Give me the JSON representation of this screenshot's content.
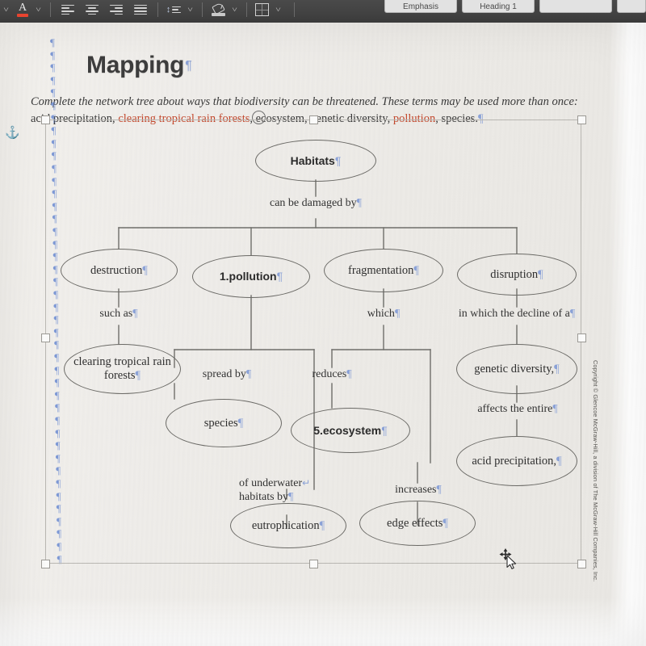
{
  "toolbar": {
    "font_color": {
      "icon": "font-color-A-icon",
      "swatch_color": "#e8442f"
    },
    "items": [
      {
        "icon": "chevron-down-icon"
      },
      {
        "icon": "align-left-icon"
      },
      {
        "icon": "align-center-icon"
      },
      {
        "icon": "align-right-icon"
      },
      {
        "icon": "align-justify-icon"
      },
      {
        "icon": "line-spacing-icon"
      },
      {
        "icon": "shading-icon"
      },
      {
        "icon": "borders-icon"
      }
    ],
    "style_gallery": [
      {
        "label": "Emphasis"
      },
      {
        "label": "Heading 1"
      },
      {
        "label": ""
      },
      {
        "label": ""
      }
    ]
  },
  "document": {
    "title": "Mapping",
    "title_pilcrow": "¶",
    "instructions": {
      "line1_italic": "Complete the network tree about ways that biodiversity can be threatened. These terms may be used more than",
      "line2_italic_lead": "once:",
      "term_1": " acid precipitation, ",
      "term_2": "clearing tropical rain forests",
      "sep_2": ", ",
      "term_3": "ecosystem",
      "sep_3": ", ",
      "term_4": "genetic diversity",
      "sep_4": ", ",
      "term_5": "pollution",
      "sep_5": ", ",
      "term_6": "species.",
      "pilcrow": "¶"
    },
    "copyright": "Copyright © Glencoe McGraw-Hill, a division of The McGraw-Hill Companies, Inc."
  },
  "selection": {
    "handle_name": "resize-handle",
    "anchor_icon": "object-anchor-icon"
  },
  "pilcrow_mark": "¶",
  "line_break_mark": "↵",
  "diagram": {
    "nodes": [
      {
        "id": "habitats",
        "label": "Habitats",
        "bold": true,
        "pilcrow": "¶"
      },
      {
        "id": "destruction",
        "label": "destruction",
        "bold": false,
        "pilcrow": "¶"
      },
      {
        "id": "pollution",
        "label": "1.pollution",
        "bold": true,
        "pilcrow": "¶"
      },
      {
        "id": "fragmentation",
        "label": "fragmentation",
        "bold": false,
        "pilcrow": "¶"
      },
      {
        "id": "disruption",
        "label": "disruption",
        "bold": false,
        "pilcrow": "¶"
      },
      {
        "id": "clearing",
        "label": "clearing tropical rain forests",
        "bold": false,
        "pilcrow": "¶"
      },
      {
        "id": "species",
        "label": "species",
        "bold": false,
        "pilcrow": "¶"
      },
      {
        "id": "ecosystem",
        "label": "5.ecosystem",
        "bold": true,
        "pilcrow": "¶"
      },
      {
        "id": "genetic",
        "label": "genetic diversity,",
        "bold": false,
        "pilcrow": "¶"
      },
      {
        "id": "acid",
        "label": "acid precipitation,",
        "bold": false,
        "pilcrow": "¶"
      },
      {
        "id": "eutrophication",
        "label": "eutrophication",
        "bold": false,
        "pilcrow": "¶"
      },
      {
        "id": "edge_effects",
        "label": "edge effects",
        "bold": false,
        "pilcrow": "¶"
      }
    ],
    "edge_labels": [
      {
        "id": "can_be_damaged_by",
        "text": "can be damaged by",
        "pilcrow": "¶"
      },
      {
        "id": "such_as",
        "text": "such as",
        "pilcrow": "¶"
      },
      {
        "id": "spread_by",
        "text": "spread by",
        "pilcrow": "¶"
      },
      {
        "id": "which",
        "text": "which",
        "pilcrow": "¶"
      },
      {
        "id": "reduces",
        "text": "reduces",
        "pilcrow": "¶"
      },
      {
        "id": "in_which",
        "text": "in which the decline of a",
        "pilcrow": "¶"
      },
      {
        "id": "affects_entire",
        "text": "affects the entire",
        "pilcrow": "¶"
      },
      {
        "id": "of_underwater_l1",
        "text": "of underwater",
        "pilcrow": "↵"
      },
      {
        "id": "of_underwater_l2",
        "text": "habitats by",
        "pilcrow": "¶"
      },
      {
        "id": "increases",
        "text": "increases",
        "pilcrow": "¶"
      }
    ]
  },
  "cursor": {
    "icon": "move-cursor-icon"
  },
  "colors": {
    "toolbar_bg": "#424242",
    "page_bg": "#efedea",
    "pilcrow_blue": "#8ca3d8",
    "term_red": "#c3492e",
    "ink": "#2f2f2f",
    "oval_stroke": "#6b6a66",
    "accent_swatch": "#e8442f"
  }
}
